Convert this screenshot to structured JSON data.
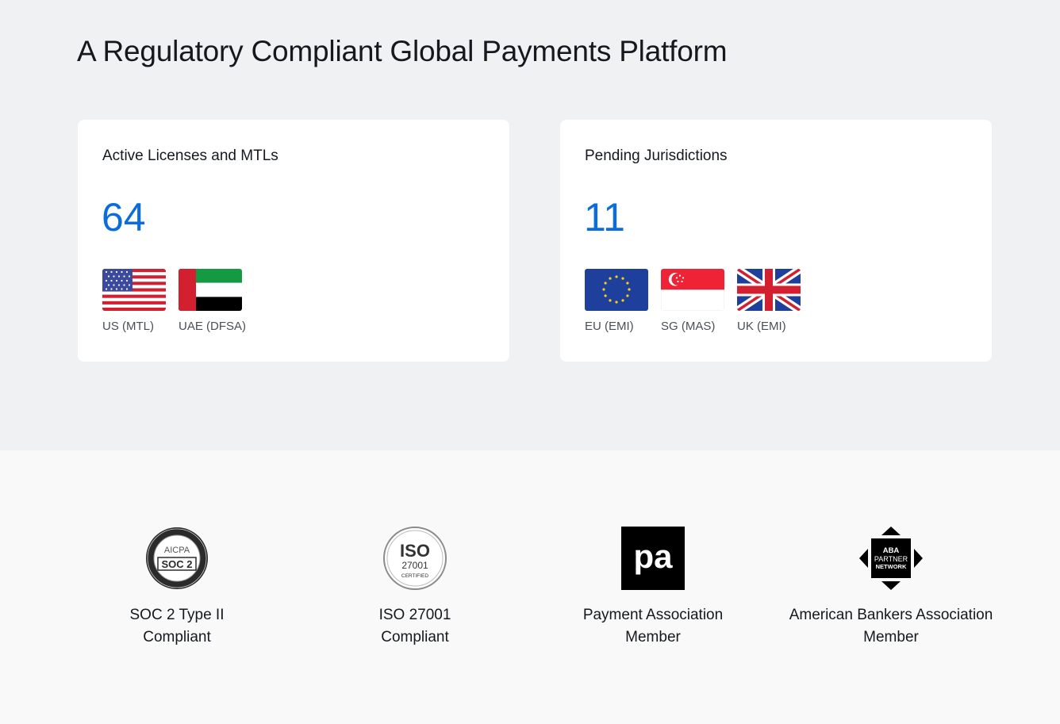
{
  "page": {
    "title": "A Regulatory Compliant Global Payments Platform"
  },
  "colors": {
    "accent": "#0b6cdd",
    "top_background": "#f0f1f3",
    "bottom_background": "#f9f9f9",
    "card_background": "#ffffff"
  },
  "cards": [
    {
      "title": "Active Licenses and MTLs",
      "count": "64",
      "flags": [
        {
          "icon": "us-flag-icon",
          "label": "US (MTL)"
        },
        {
          "icon": "uae-flag-icon",
          "label": "UAE (DFSA)"
        }
      ]
    },
    {
      "title": "Pending Jurisdictions",
      "count": "11",
      "flags": [
        {
          "icon": "eu-flag-icon",
          "label": "EU (EMI)"
        },
        {
          "icon": "sg-flag-icon",
          "label": "SG (MAS)"
        },
        {
          "icon": "uk-flag-icon",
          "label": "UK (EMI)"
        }
      ]
    }
  ],
  "badges": [
    {
      "icon": "soc2-badge-icon",
      "logo_text": [
        "AICPA",
        "SOC 2"
      ],
      "name": "SOC 2 Type II",
      "status": "Compliant"
    },
    {
      "icon": "iso-badge-icon",
      "logo_text": [
        "ISO",
        "27001",
        "CERTIFIED"
      ],
      "name": "ISO 27001",
      "status": "Compliant"
    },
    {
      "icon": "payment-association-logo-icon",
      "logo_text": [
        "pa"
      ],
      "name": "Payment Association",
      "status": "Member"
    },
    {
      "icon": "aba-partner-network-logo-icon",
      "logo_text": [
        "ABA",
        "PARTNER",
        "NETWORK"
      ],
      "name": "American Bankers Association",
      "status": "Member"
    }
  ]
}
